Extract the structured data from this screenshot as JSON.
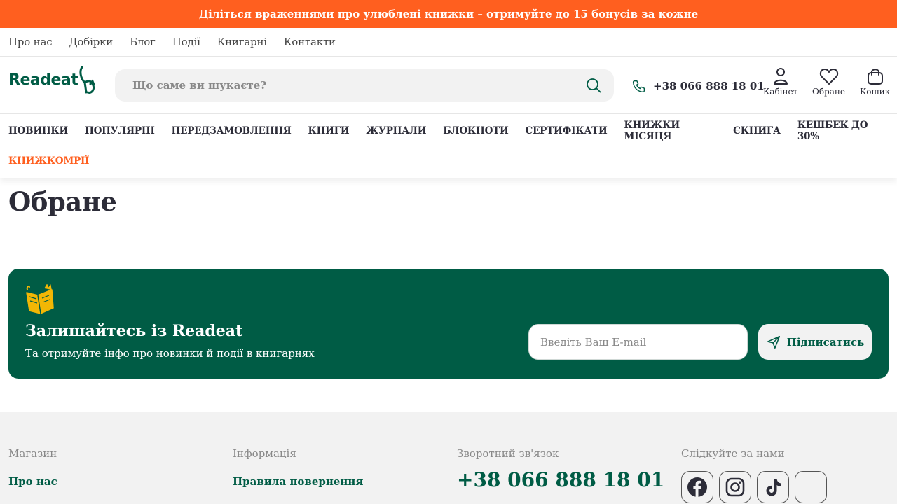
{
  "promo": {
    "text": "Діліться враженнями про улюблені книжки – отримуйте до 15 бонусів за кожне"
  },
  "topnav": {
    "items": [
      "Про нас",
      "Добірки",
      "Блог",
      "Події",
      "Книгарні",
      "Контакти"
    ]
  },
  "header": {
    "logo_text": "Readeat",
    "search_placeholder": "Що саме ви шукаєте?",
    "phone": "+38 066 888 18 01",
    "account_label": "Кабінет",
    "favorites_label": "Обране",
    "cart_label": "Кошик"
  },
  "categories": {
    "row1": [
      "НОВИНКИ",
      "ПОПУЛЯРНІ",
      "ПЕРЕДЗАМОВЛЕННЯ",
      "КНИГИ",
      "ЖУРНАЛИ",
      "БЛОКНОТИ",
      "СЕРТИФІКАТИ",
      "КНИЖКИ МІСЯЦЯ",
      "ЄКНИГА",
      "КЕШБЕК ДО 30%"
    ],
    "accent": "КНИЖКОМРІЇ"
  },
  "main": {
    "title": "Обране"
  },
  "subscribe": {
    "title": "Залишайтесь із Readeat",
    "text": "Та отримуйте інфо про новинки й події в книгарнях",
    "email_placeholder": "Введіть Ваш E-mail",
    "button_label": "Підписатись"
  },
  "footer": {
    "shop_heading": "Магазин",
    "shop_link": "Про нас",
    "info_heading": "Інформація",
    "info_link": "Правила повернення",
    "contact_heading": "Зворотний зв'язок",
    "contact_phone": "+38 066 888 18 01",
    "social_heading": "Слідкуйте за нами",
    "socials": [
      "facebook-icon",
      "instagram-icon",
      "tiktok-icon",
      "other-icon"
    ]
  },
  "colors": {
    "brand": "#005c45",
    "accent": "#ff5f1f",
    "surface": "#f2f2f2"
  }
}
